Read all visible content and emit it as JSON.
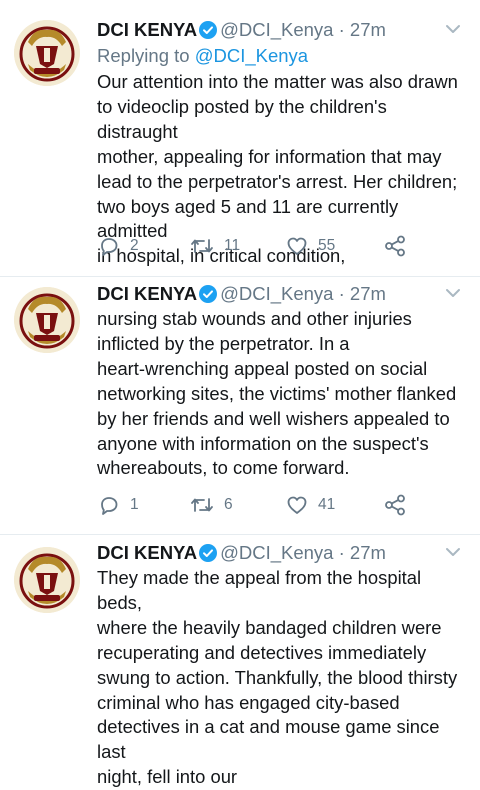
{
  "colors": {
    "accent": "#1b95e0",
    "muted": "#657786",
    "text": "#14171a",
    "verified": "#1da1f2"
  },
  "icons": {
    "verified": "verified-badge-icon",
    "menu": "chevron-down-icon",
    "reply": "reply-icon",
    "retweet": "retweet-icon",
    "like": "heart-icon",
    "share": "share-icon",
    "avatar": "dci-logo"
  },
  "tweets": [
    {
      "name": "DCI KENYA",
      "handle": "@DCI_Kenya",
      "sep": "·",
      "time": "27m",
      "replying_label": "Replying to",
      "replying_handle": "@DCI_Kenya",
      "text": "Our attention into the matter was also drawn\nto videoclip posted by the children's distraught\nmother, appealing for information that may\nlead to the perpetrator's arrest. Her children;\ntwo boys aged 5 and 11 are currently admitted\nin hospital, in critical condition,",
      "replies": "2",
      "retweets": "11",
      "likes": "55"
    },
    {
      "name": "DCI KENYA",
      "handle": "@DCI_Kenya",
      "sep": "·",
      "time": "27m",
      "text": "nursing stab wounds and other injuries\ninflicted by the perpetrator.  In a\nheart-wrenching appeal posted on social\nnetworking sites, the victims' mother flanked\nby her friends and well wishers appealed to\nanyone with information on the suspect's\nwhereabouts, to come forward.",
      "replies": "1",
      "retweets": "6",
      "likes": "41"
    },
    {
      "name": "DCI KENYA",
      "handle": "@DCI_Kenya",
      "sep": "·",
      "time": "27m",
      "text": "They made the appeal from the hospital beds,\nwhere the heavily bandaged children were\nrecuperating and detectives immediately\nswung to action. Thankfully, the blood thirsty\ncriminal who has engaged city-based\ndetectives in a cat and mouse game since last\nnight, fell into our"
    }
  ]
}
